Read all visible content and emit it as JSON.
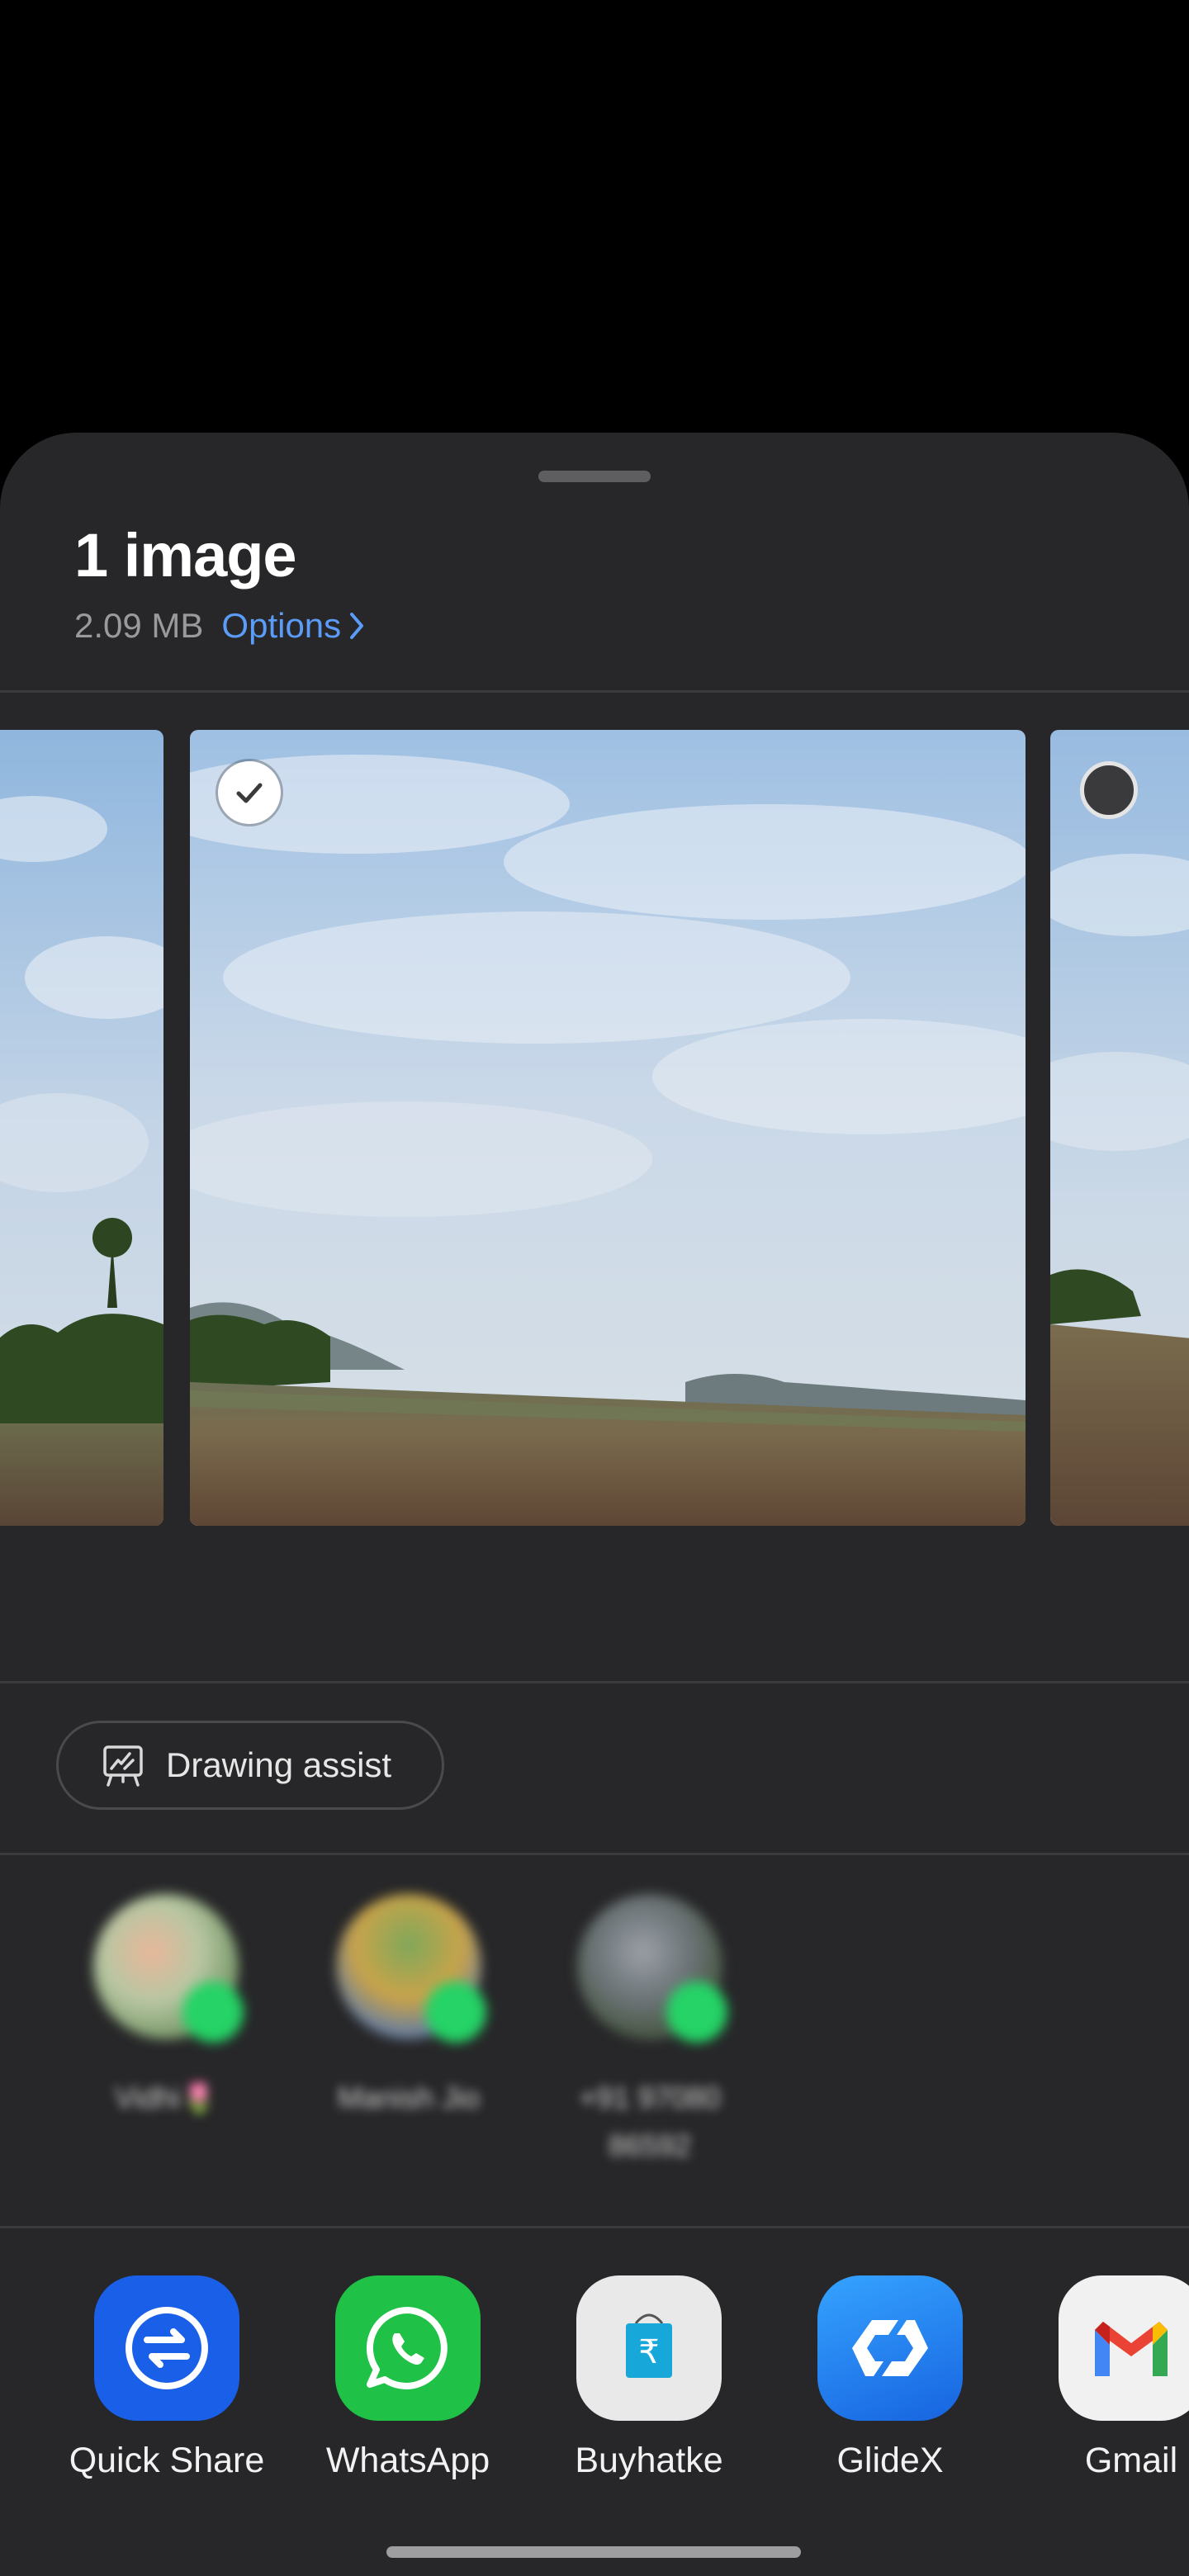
{
  "sheet": {
    "title": "1 image",
    "size": "2.09 MB",
    "options_label": "Options"
  },
  "preview": {
    "selected_index": 1,
    "items": [
      {
        "selected": false
      },
      {
        "selected": true
      },
      {
        "selected": false
      }
    ]
  },
  "actions": {
    "drawing_assist_label": "Drawing assist"
  },
  "contacts": [
    {
      "name_line1": "Vidhi🌷",
      "name_line2": ""
    },
    {
      "name_line1": "Manish Jio",
      "name_line2": ""
    },
    {
      "name_line1": "+91 97080",
      "name_line2": "86592"
    }
  ],
  "apps": [
    {
      "label": "Quick Share",
      "icon": "quick-share-icon",
      "color": "#1a5fe8"
    },
    {
      "label": "WhatsApp",
      "icon": "whatsapp-icon",
      "color": "#1fc146"
    },
    {
      "label": "Buyhatke",
      "icon": "buyhatke-icon",
      "color": "#e9e9ea"
    },
    {
      "label": "GlideX",
      "icon": "glidex-icon",
      "color": "#1e7ff0"
    },
    {
      "label": "Gmail",
      "icon": "gmail-icon",
      "color": "#f1f1f1"
    }
  ]
}
